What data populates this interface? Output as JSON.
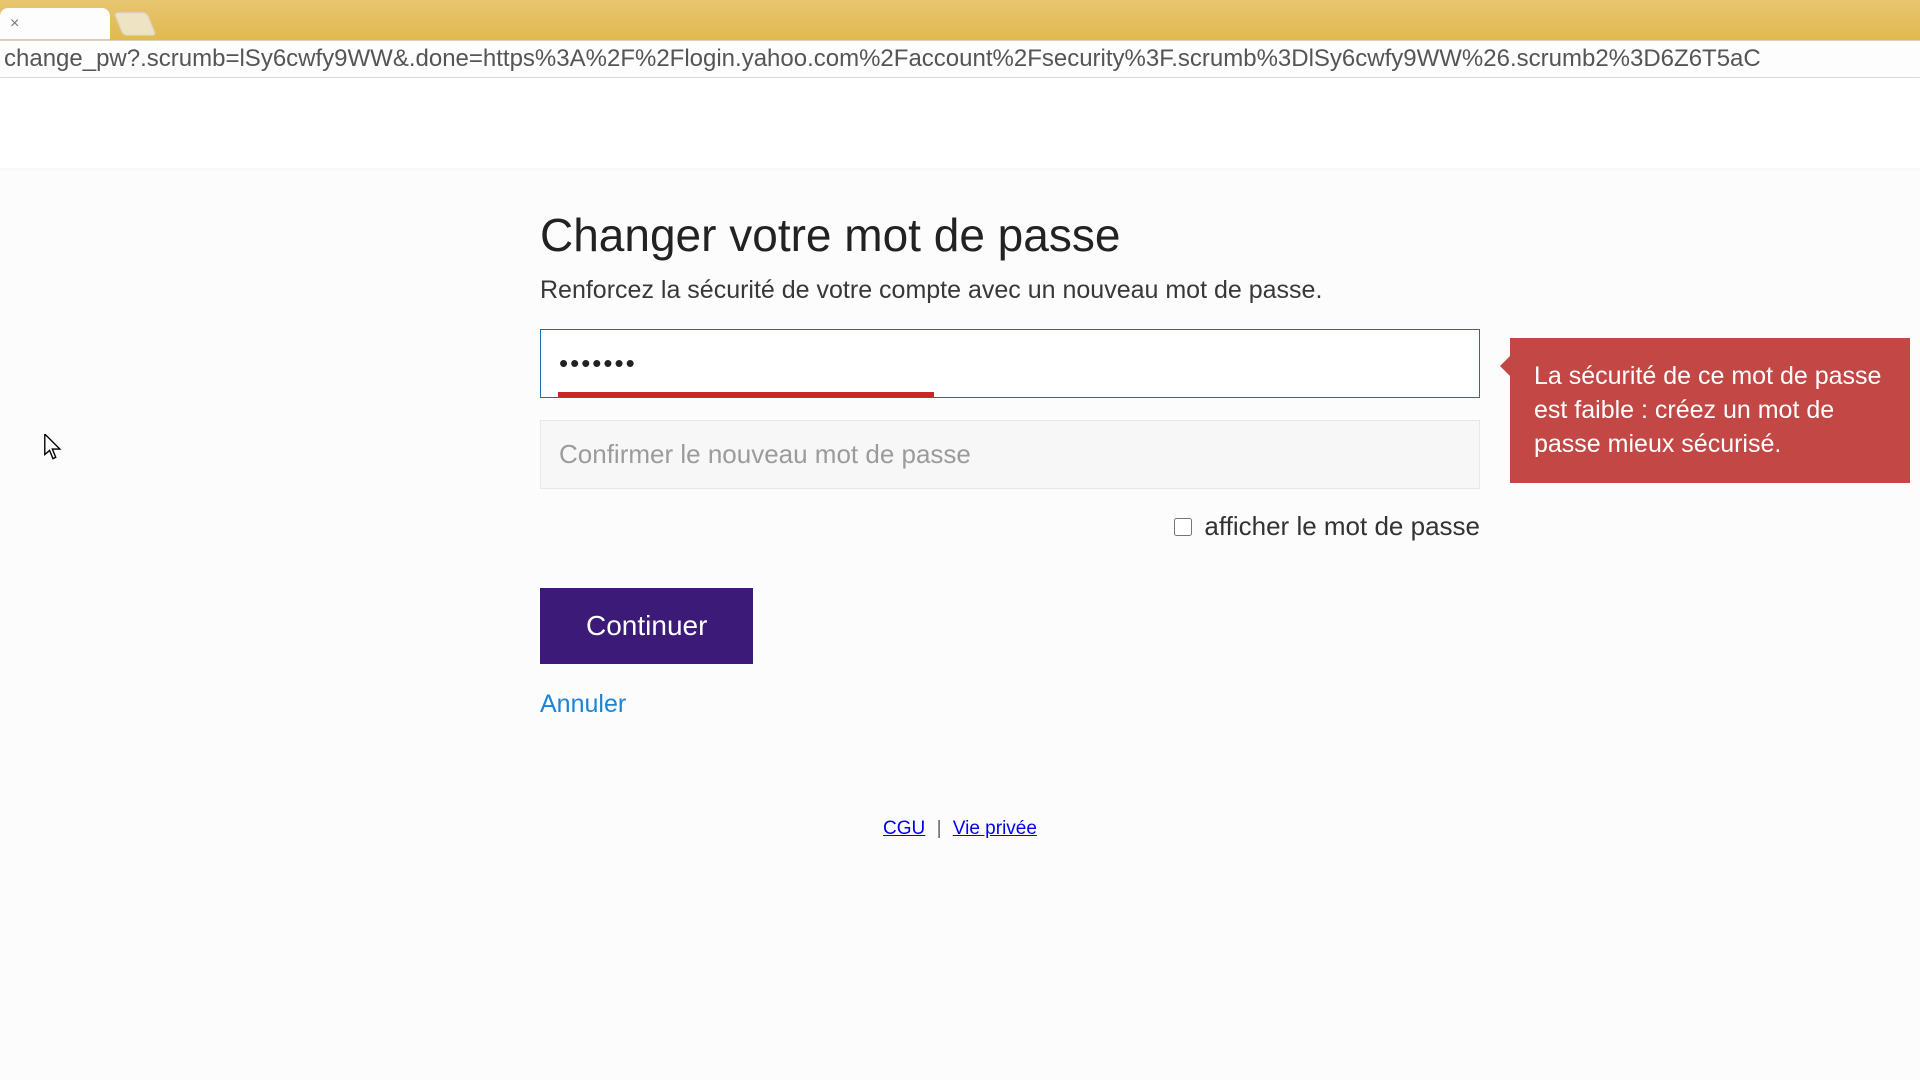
{
  "browser": {
    "url": "change_pw?.scrumb=lSy6cwfy9WW&.done=https%3A%2F%2Flogin.yahoo.com%2Faccount%2Fsecurity%3F.scrumb%3DlSy6cwfy9WW%26.scrumb2%3D6Z6T5aC"
  },
  "page": {
    "title": "Changer votre mot de passe",
    "subtitle": "Renforcez la sécurité de votre compte avec un nouveau mot de passe."
  },
  "form": {
    "password_value": "•••••••",
    "confirm_placeholder": "Confirmer le nouveau mot de passe",
    "show_password_label": "afficher le mot de passe",
    "continue_label": "Continuer",
    "cancel_label": "Annuler",
    "strength_percent": 40,
    "strength_color": "#c72827"
  },
  "tooltip": {
    "text": "La sécurité de ce mot de passe est faible : créez un mot de passe mieux sécurisé."
  },
  "footer": {
    "terms": "CGU",
    "privacy": "Vie privée"
  }
}
